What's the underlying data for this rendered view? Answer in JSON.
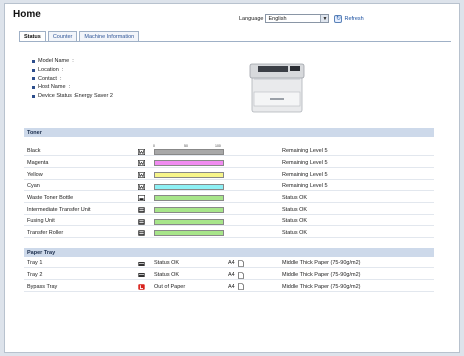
{
  "header": {
    "title": "Home",
    "language_label": "Language",
    "language_value": "English",
    "refresh_label": "Refresh"
  },
  "tabs": [
    {
      "label": "Status",
      "active": true
    },
    {
      "label": "Counter",
      "active": false
    },
    {
      "label": "Machine Information",
      "active": false
    }
  ],
  "device_info": [
    {
      "label": "Model Name",
      "value": ":"
    },
    {
      "label": "Location",
      "value": ":"
    },
    {
      "label": "Contact",
      "value": ":"
    },
    {
      "label": "Host Name",
      "value": ":"
    },
    {
      "label": "Device Status",
      "value": ":Energy Saver 2"
    }
  ],
  "toner": {
    "title": "Toner",
    "scale": [
      "0",
      "50",
      "100"
    ],
    "items": [
      {
        "label": "Black",
        "fill": 1.0,
        "color": "#a8a8a8",
        "status": "Remaining Level 5",
        "icon": "toner-icon"
      },
      {
        "label": "Magenta",
        "fill": 1.0,
        "color": "#f08cf0",
        "status": "Remaining Level 5",
        "icon": "toner-icon"
      },
      {
        "label": "Yellow",
        "fill": 1.0,
        "color": "#f7f58a",
        "status": "Remaining Level 5",
        "icon": "toner-icon"
      },
      {
        "label": "Cyan",
        "fill": 1.0,
        "color": "#8ef0f4",
        "status": "Remaining Level 5",
        "icon": "toner-icon"
      },
      {
        "label": "Waste Toner Bottle",
        "fill": 1.0,
        "color": "#a7e58a",
        "status": "Status OK",
        "icon": "waste-bottle-icon"
      },
      {
        "label": "Intermediate Transfer Unit",
        "fill": 1.0,
        "color": "#a7e58a",
        "status": "Status OK",
        "icon": "unit-icon"
      },
      {
        "label": "Fusing Unit",
        "fill": 1.0,
        "color": "#a7e58a",
        "status": "Status OK",
        "icon": "unit-icon"
      },
      {
        "label": "Transfer Roller",
        "fill": 1.0,
        "color": "#a7e58a",
        "status": "Status OK",
        "icon": "unit-icon"
      }
    ]
  },
  "paper_tray": {
    "title": "Paper Tray",
    "items": [
      {
        "label": "Tray 1",
        "status": "Status OK",
        "size": "A4",
        "type": "Middle Thick Paper (75-90g/m2)",
        "icon": "tray-icon"
      },
      {
        "label": "Tray 2",
        "status": "Status OK",
        "size": "A4",
        "type": "Middle Thick Paper (75-90g/m2)",
        "icon": "tray-icon"
      },
      {
        "label": "Bypass Tray",
        "status": "Out of Paper",
        "size": "A4",
        "type": "Middle Thick Paper (75-90g/m2)",
        "icon": "tray-error-icon"
      }
    ]
  }
}
